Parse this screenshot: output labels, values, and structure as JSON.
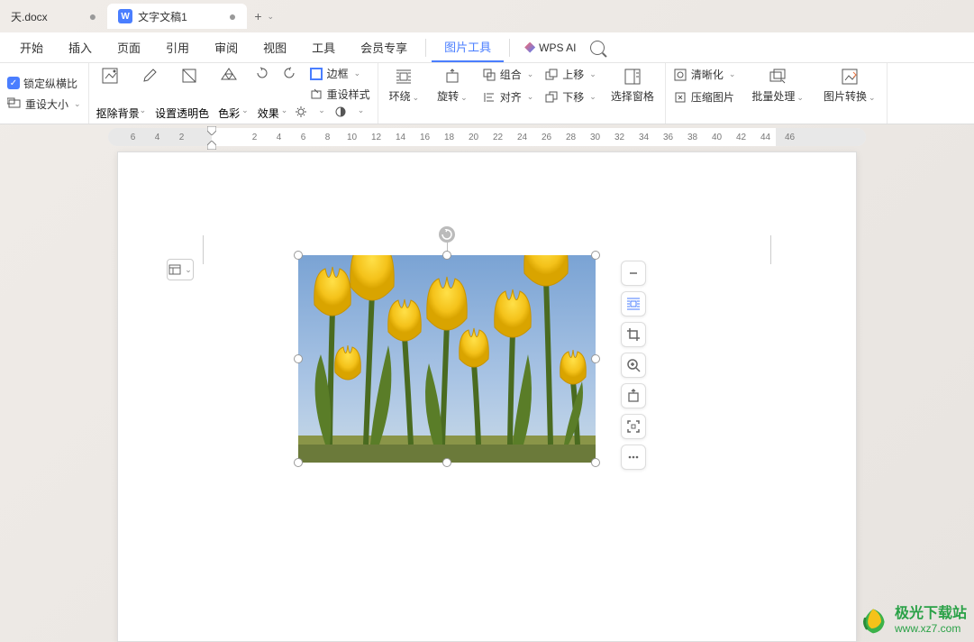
{
  "tabs": [
    {
      "label": "天.docx"
    },
    {
      "label": "文字文稿1",
      "icon": "W"
    }
  ],
  "menu": {
    "items": [
      "开始",
      "插入",
      "页面",
      "引用",
      "审阅",
      "视图",
      "工具",
      "会员专享",
      "图片工具"
    ],
    "active_index": 8,
    "ai_label": "WPS AI"
  },
  "toolbar": {
    "lock_aspect": "锁定纵横比",
    "reset_size": "重设大小",
    "remove_bg": "抠除背景",
    "set_transparent": "设置透明色",
    "color": "色彩",
    "effect": "效果",
    "border": "边框",
    "reset_style": "重设样式",
    "wrap": "环绕",
    "rotate": "旋转",
    "group": "组合",
    "align": "对齐",
    "bring_forward": "上移",
    "send_backward": "下移",
    "selection_pane": "选择窗格",
    "clarity": "清晰化",
    "compress": "压缩图片",
    "batch": "批量处理",
    "convert": "图片转换"
  },
  "ruler": {
    "left_nums": [
      "6",
      "4",
      "2"
    ],
    "right_nums": [
      "2",
      "4",
      "6",
      "8",
      "10",
      "12",
      "14",
      "16",
      "18",
      "20",
      "22",
      "24",
      "26",
      "28",
      "30",
      "32",
      "34",
      "36",
      "38",
      "40",
      "42",
      "44",
      "46"
    ]
  },
  "watermark": {
    "name": "极光下载站",
    "url": "www.xz7.com"
  }
}
